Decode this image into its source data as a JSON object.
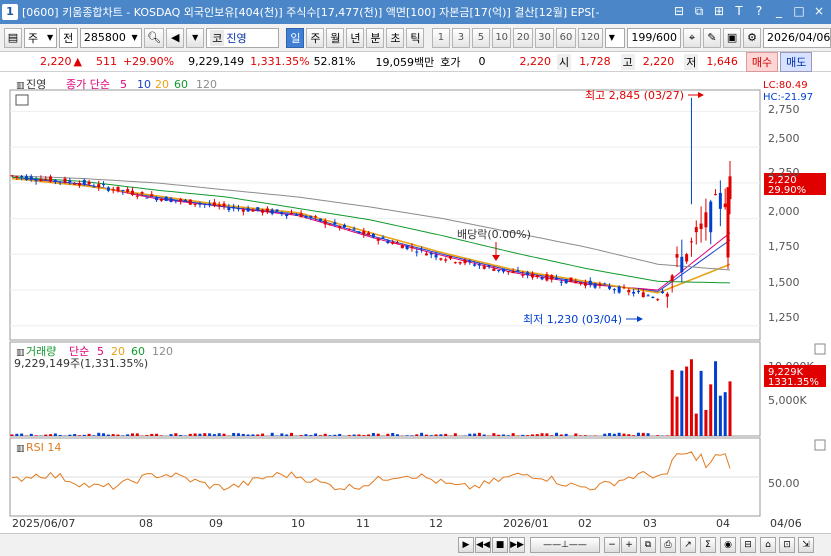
{
  "window": {
    "app_number": "1",
    "title": "[0600] 키움종합차트 - KOSDAQ 외국인보유[404(천)] 주식수[17,477(천)] 액면[100] 자본금[17(억)] 결산[12월] EPS[-",
    "controls": [
      "⊟",
      "⧉",
      "⊞",
      "T",
      "?",
      "_",
      "□",
      "×"
    ]
  },
  "toolbar": {
    "market_type": "주",
    "market_value": "전",
    "stock_code": "285800",
    "code_prefix": "코",
    "stock_name": "진영",
    "periods": [
      "일",
      "주",
      "월",
      "년",
      "분",
      "초",
      "틱"
    ],
    "active_period": "일",
    "intervals": [
      "1",
      "3",
      "5",
      "10",
      "20",
      "30",
      "60",
      "120"
    ],
    "count": "199/600",
    "date": "2026/04/06"
  },
  "quote": {
    "price": "2,220",
    "change": "511",
    "change_pct": "+29.90%",
    "volume": "9,229,149",
    "volume_pct": "1,331.35%",
    "turnover": "52.81%",
    "amount": "19,059백만",
    "hoga_label": "호가",
    "hoga_value": "0",
    "hoga_price": "2,220",
    "open_label": "시",
    "open": "1,728",
    "high_label": "고",
    "high": "2,220",
    "low_label": "저",
    "low": "1,646",
    "buy_label": "매수",
    "sell_label": "매도"
  },
  "price_panel": {
    "name_tag": "진영",
    "legend": {
      "label": "종가 단순",
      "periods": [
        "5",
        "10",
        "20",
        "60",
        "120"
      ]
    },
    "lc": "LC:80.49",
    "hc": "HC:-21.97",
    "high_annotation": "최고 2,845 (03/27)",
    "low_annotation": "최저 1,230 (03/04)",
    "dividend_annotation": "배당락(0.00%)",
    "current_price_tag": "2,220",
    "current_pct_tag": "29.90%",
    "y_ticks": [
      "2,750",
      "2,500",
      "2,250",
      "2,000",
      "1,750",
      "1,500",
      "1,250"
    ]
  },
  "volume_panel": {
    "label": "거래량",
    "legend": {
      "label": "단순",
      "periods": [
        "5",
        "20",
        "60",
        "120"
      ]
    },
    "value": "9,229,149주(1,331.35%)",
    "y_ticks": [
      "10,000K",
      "5,000K"
    ],
    "current_tag": "9,229K",
    "current_pct_tag": "1331.35%"
  },
  "rsi_panel": {
    "label": "RSI 14",
    "y_ticks": [
      "50.00"
    ]
  },
  "x_axis": {
    "labels": [
      "2025/06/07",
      "08",
      "09",
      "10",
      "11",
      "12",
      "2026/01",
      "02",
      "03",
      "04",
      "04/06"
    ]
  },
  "colors": {
    "up": "#e00000",
    "down": "#0040d0",
    "ma5": "#e0007a",
    "ma10": "#1b3fd1",
    "ma20": "#e8a317",
    "ma60": "#119a2d",
    "ma120": "#8c8c8c",
    "rsi": "#e07a20"
  },
  "chart_data": {
    "type": "candlestick",
    "title": "진영 (285800) 일봉",
    "y_range": [
      1150,
      2900
    ],
    "x": [
      "2025/06",
      "2025/07",
      "2025/08",
      "2025/09",
      "2025/10",
      "2025/11",
      "2025/12",
      "2026/01",
      "2026/02",
      "2026/03",
      "2026/04/06"
    ],
    "close_approx": [
      2300,
      2250,
      2150,
      2080,
      2030,
      1880,
      1730,
      1620,
      1550,
      1450,
      2220
    ],
    "series": [
      {
        "name": "5",
        "values": [
          2290,
          2240,
          2140,
          2080,
          2020,
          1870,
          1740,
          1620,
          1540,
          1500,
          1900
        ]
      },
      {
        "name": "10",
        "values": [
          2290,
          2240,
          2150,
          2080,
          2030,
          1880,
          1750,
          1630,
          1550,
          1490,
          1850
        ]
      },
      {
        "name": "20",
        "values": [
          2280,
          2230,
          2160,
          2090,
          2040,
          1900,
          1760,
          1640,
          1560,
          1480,
          1680
        ]
      },
      {
        "name": "60",
        "values": [
          2290,
          2260,
          2200,
          2150,
          2070,
          1990,
          1880,
          1760,
          1650,
          1560,
          1550
        ]
      },
      {
        "name": "120",
        "values": [
          2300,
          2280,
          2250,
          2200,
          2150,
          2080,
          2000,
          1900,
          1800,
          1680,
          1640
        ]
      }
    ],
    "extremes": {
      "high": 2845,
      "high_date": "03/27",
      "low": 1230,
      "low_date": "03/04"
    },
    "last": {
      "open": 1728,
      "high": 2220,
      "low": 1646,
      "close": 2220,
      "volume": 9229149
    }
  }
}
